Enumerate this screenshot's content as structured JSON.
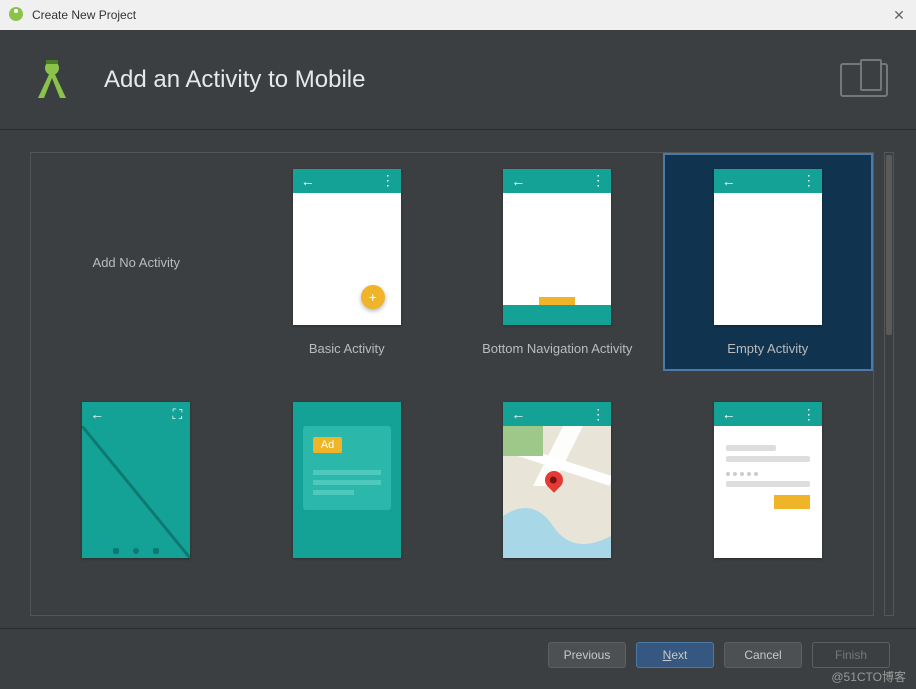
{
  "window": {
    "title": "Create New Project"
  },
  "header": {
    "title": "Add an Activity to Mobile"
  },
  "templates": [
    {
      "label": "Add No Activity",
      "type": "none"
    },
    {
      "label": "Basic Activity",
      "type": "basic"
    },
    {
      "label": "Bottom Navigation Activity",
      "type": "bottomnav"
    },
    {
      "label": "Empty Activity",
      "type": "empty",
      "selected": true
    },
    {
      "label": "",
      "type": "fullscreen"
    },
    {
      "label": "",
      "type": "ad"
    },
    {
      "label": "",
      "type": "map"
    },
    {
      "label": "",
      "type": "login"
    }
  ],
  "ad_badge": "Ad",
  "buttons": {
    "previous": "Previous",
    "next": "Next",
    "cancel": "Cancel",
    "finish": "Finish"
  },
  "watermark": "@51CTO博客"
}
